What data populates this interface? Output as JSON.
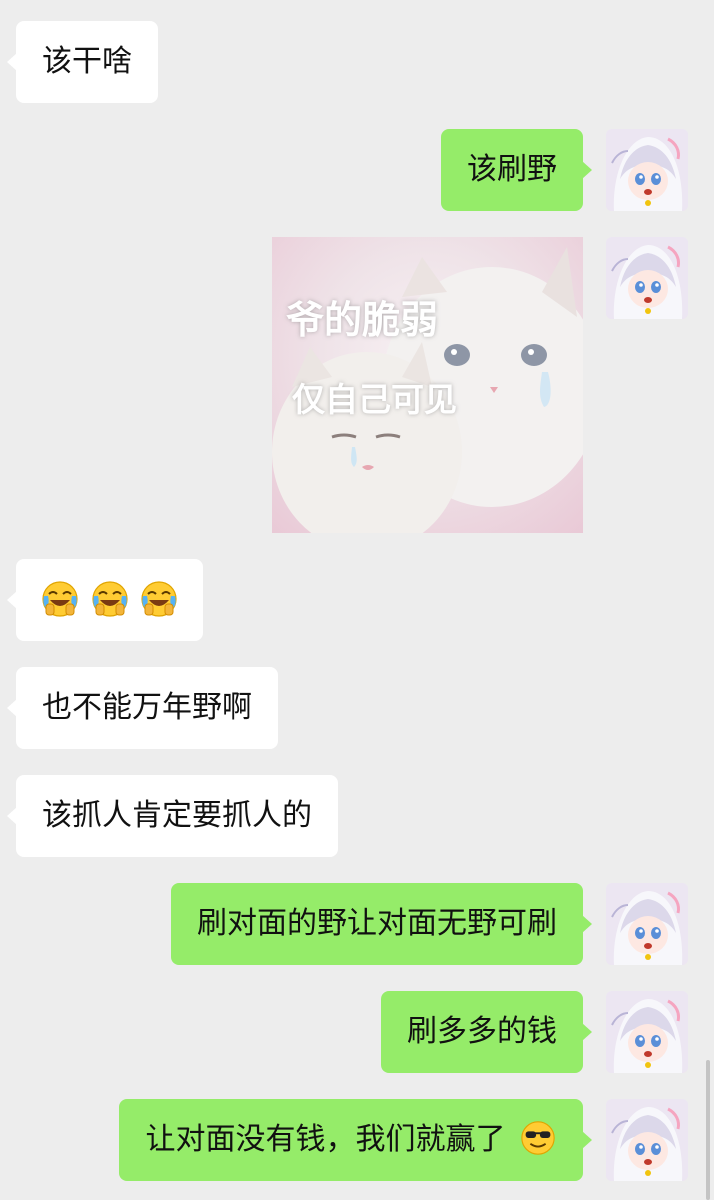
{
  "messages": [
    {
      "side": "left",
      "text": "该干啥"
    },
    {
      "side": "right",
      "text": "该刷野"
    },
    {
      "side": "right",
      "sticker": {
        "line1": "爷的脆弱",
        "line2": "仅自己可见"
      }
    },
    {
      "side": "left",
      "emoji": [
        "face-with-tears-of-joy",
        "face-with-tears-of-joy",
        "face-with-tears-of-joy"
      ]
    },
    {
      "side": "left",
      "text": "也不能万年野啊"
    },
    {
      "side": "left",
      "text": "该抓人肯定要抓人的"
    },
    {
      "side": "right",
      "text": "刷对面的野让对面无野可刷"
    },
    {
      "side": "right",
      "text": "刷多多的钱"
    },
    {
      "side": "right",
      "text": "让对面没有钱，我们就赢了",
      "trailing_emoji": "smiling-face-with-sunglasses"
    }
  ],
  "colors": {
    "background": "#ededed",
    "incoming_bubble": "#ffffff",
    "outgoing_bubble": "#95ec69"
  },
  "icons": {
    "avatar": "anime-avatar-icon",
    "laugh": "face-with-tears-of-joy",
    "cool": "smiling-face-with-sunglasses"
  }
}
